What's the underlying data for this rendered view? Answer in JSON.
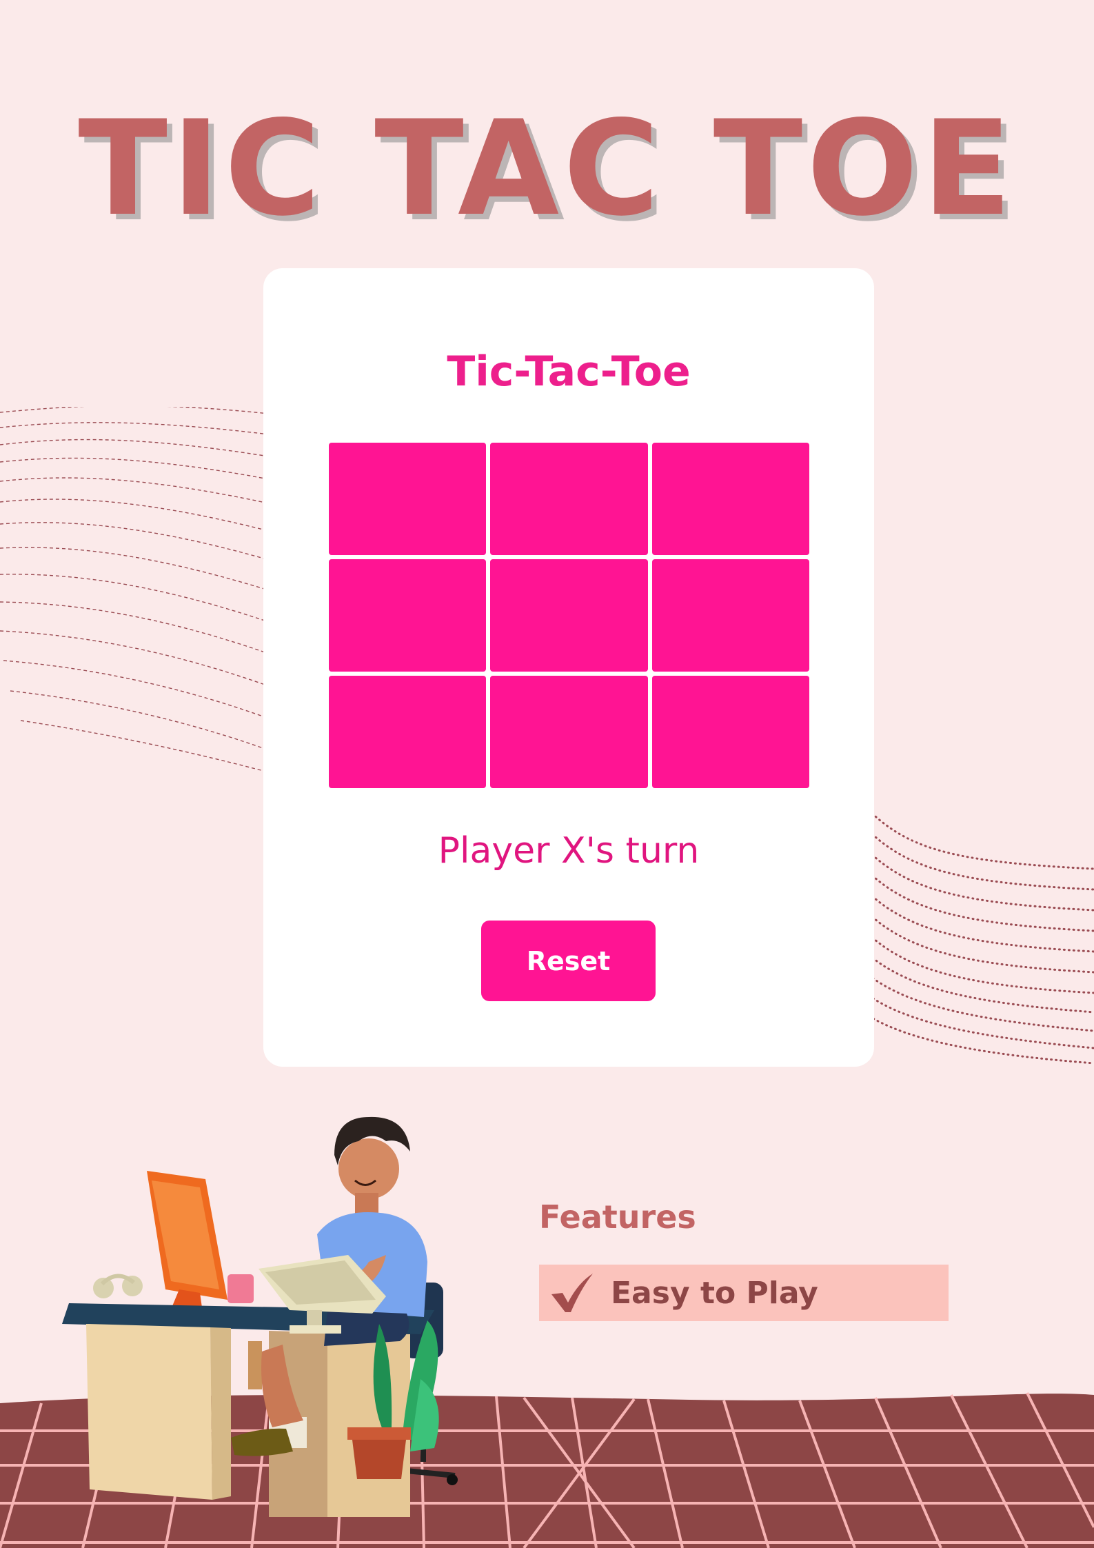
{
  "poster": {
    "title": "TIC TAC TOE"
  },
  "game": {
    "title": "Tic-Tac-Toe",
    "status": "Player X's turn",
    "reset_label": "Reset",
    "board": [
      "",
      "",
      "",
      "",
      "",
      "",
      "",
      "",
      ""
    ]
  },
  "features": {
    "heading": "Features",
    "items": [
      {
        "label": "Easy to Play",
        "icon": "checkmark-icon"
      }
    ]
  },
  "colors": {
    "background": "#fbeaea",
    "poster_title": "#c26464",
    "accent": "#ff1493",
    "feature_bg": "#fbc3bc",
    "floor": "#8d4646",
    "floor_lines": "#f7b4b4"
  },
  "illustration": {
    "icon": "person-at-desk-illustration"
  }
}
